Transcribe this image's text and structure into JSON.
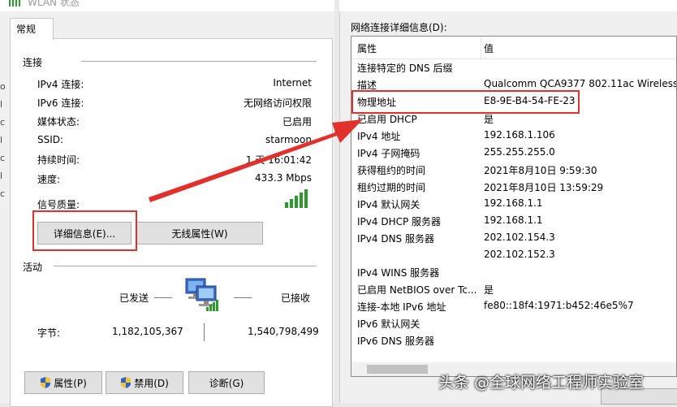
{
  "left_dialog": {
    "title": "WLAN 状态",
    "tab": "常规",
    "connection": {
      "title": "连接",
      "rows": [
        {
          "label": "IPv4 连接:",
          "value": "Internet"
        },
        {
          "label": "IPv6 连接:",
          "value": "无网络访问权限"
        },
        {
          "label": "媒体状态:",
          "value": "已启用"
        },
        {
          "label": "SSID:",
          "value": "starmoon"
        },
        {
          "label": "持续时间:",
          "value": "1 天 16:01:42"
        },
        {
          "label": "速度:",
          "value": "433.3 Mbps"
        }
      ],
      "signal_label": "信号质量:",
      "signal_bars": 5
    },
    "buttons": {
      "details": "详细信息(E)...",
      "wireless": "无线属性(W)"
    },
    "activity": {
      "title": "活动",
      "sent_label": "已发送",
      "received_label": "已接收",
      "bytes_label": "字节:",
      "sent_value": "1,182,105,367",
      "received_value": "1,540,798,499"
    },
    "bottom_buttons": {
      "properties": "属性(P)",
      "disable": "禁用(D)",
      "diagnose": "诊断(G)"
    },
    "edge_glyphs": [
      "o",
      "l",
      "c",
      "l",
      "c",
      "l",
      "c"
    ]
  },
  "right_dialog": {
    "label": "网络连接详细信息(D):",
    "columns": {
      "property": "属性",
      "value": "值"
    },
    "rows": [
      {
        "p": "连接特定的 DNS 后缀",
        "v": ""
      },
      {
        "p": "描述",
        "v": "Qualcomm QCA9377 802.11ac Wireless"
      },
      {
        "p": "物理地址",
        "v": "E8-9E-B4-54-FE-23"
      },
      {
        "p": "已启用 DHCP",
        "v": "是"
      },
      {
        "p": "IPv4 地址",
        "v": "192.168.1.106"
      },
      {
        "p": "IPv4 子网掩码",
        "v": "255.255.255.0"
      },
      {
        "p": "获得租约的时间",
        "v": "2021年8月10日 9:59:30"
      },
      {
        "p": "租约过期的时间",
        "v": "2021年8月10日 13:59:29"
      },
      {
        "p": "IPv4 默认网关",
        "v": "192.168.1.1"
      },
      {
        "p": "IPv4 DHCP 服务器",
        "v": "192.168.1.1"
      },
      {
        "p": "IPv4 DNS 服务器",
        "v": "202.102.154.3"
      },
      {
        "p": "",
        "v": "202.102.152.3"
      },
      {
        "p": "IPv4 WINS 服务器",
        "v": ""
      },
      {
        "p": "已启用 NetBIOS over Tc...",
        "v": "是"
      },
      {
        "p": "连接-本地 IPv6 地址",
        "v": "fe80::18f4:1971:b452:46e5%7"
      },
      {
        "p": "IPv6 默认网关",
        "v": ""
      },
      {
        "p": "IPv6 DNS 服务器",
        "v": ""
      }
    ]
  },
  "watermark": "头条 @全球网络工程师实验室",
  "colors": {
    "annotation_red": "#e0312d",
    "signal_green": "#2e9a2e",
    "window_bg": "#f0f0f0"
  }
}
